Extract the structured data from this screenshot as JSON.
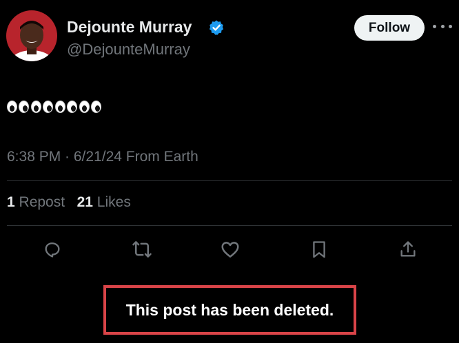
{
  "author": {
    "name": "Dejounte Murray",
    "handle": "@DejounteMurray",
    "verified": true
  },
  "header": {
    "follow_label": "Follow",
    "more_icon": "more-horizontal-icon"
  },
  "post": {
    "emoji_content": "👀👀👀👀",
    "emoji_name": "eyes-emoji",
    "emoji_count": 4,
    "timestamp": "6:38 PM · 6/21/24 From Earth"
  },
  "stats": {
    "reposts_count": "1",
    "reposts_label": "Repost",
    "likes_count": "21",
    "likes_label": "Likes"
  },
  "actions": {
    "reply_icon": "reply-icon",
    "repost_icon": "repost-icon",
    "like_icon": "like-icon",
    "bookmark_icon": "bookmark-icon",
    "share_icon": "share-icon"
  },
  "overlay": {
    "deleted_message": "This post has been deleted.",
    "highlight_color": "#d94448"
  },
  "colors": {
    "background": "#000000",
    "primary_text": "#e7e9ea",
    "secondary_text": "#71767b",
    "verified_badge": "#1d9bf0",
    "follow_button_bg": "#eff3f4"
  }
}
